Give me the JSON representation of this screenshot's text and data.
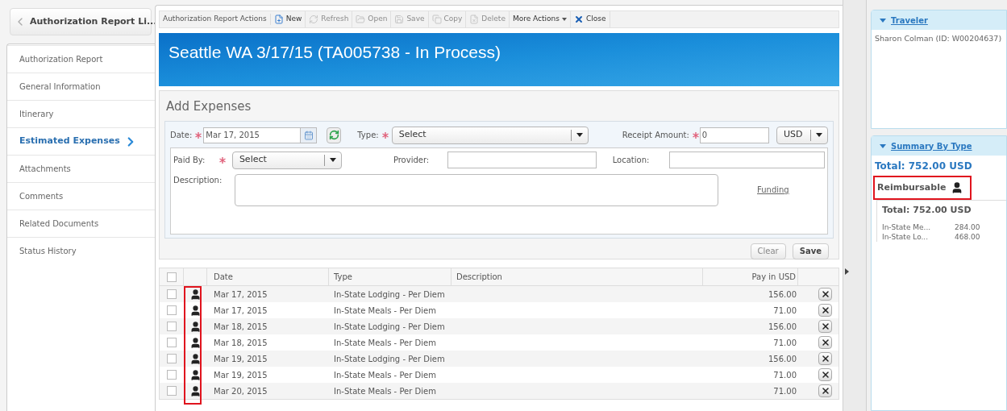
{
  "back_button": {
    "label": "Authorization Report Li..."
  },
  "nav": [
    {
      "label": "Authorization Report",
      "selected": false
    },
    {
      "label": "General Information",
      "selected": false
    },
    {
      "label": "Itinerary",
      "selected": false
    },
    {
      "label": "Estimated Expenses",
      "selected": true
    },
    {
      "label": "Attachments",
      "selected": false
    },
    {
      "label": "Comments",
      "selected": false
    },
    {
      "label": "Related Documents",
      "selected": false
    },
    {
      "label": "Status History",
      "selected": false
    }
  ],
  "toolbar": {
    "title": "Authorization Report Actions",
    "buttons": [
      {
        "kind": "new",
        "label": "New",
        "disabled": false
      },
      {
        "kind": "refresh",
        "label": "Refresh",
        "disabled": true
      },
      {
        "kind": "open",
        "label": "Open",
        "disabled": true
      },
      {
        "kind": "save",
        "label": "Save",
        "disabled": true
      },
      {
        "kind": "copy",
        "label": "Copy",
        "disabled": true
      },
      {
        "kind": "delete",
        "label": "Delete",
        "disabled": true
      },
      {
        "kind": "more",
        "label": "More Actions",
        "disabled": false
      },
      {
        "kind": "close",
        "label": "Close",
        "disabled": false
      }
    ]
  },
  "banner": {
    "title": "Seattle WA 3/17/15 (TA005738 - In Process)"
  },
  "add_expenses": {
    "title": "Add Expenses",
    "date": {
      "label": "Date:",
      "value": "Mar 17, 2015",
      "required": true
    },
    "type": {
      "label": "Type:",
      "value": "Select",
      "required": true
    },
    "receipt_amount": {
      "label": "Receipt Amount:",
      "value": "0",
      "required": true
    },
    "currency": {
      "value": "USD"
    },
    "paid_by": {
      "label": "Paid By:",
      "value": "Select",
      "required": true
    },
    "provider": {
      "label": "Provider:"
    },
    "location": {
      "label": "Location:"
    },
    "description": {
      "label": "Description:"
    },
    "funding_link": "Funding",
    "buttons": [
      "Clear",
      "Save"
    ]
  },
  "table": {
    "header_checked": false,
    "columns": [
      "Date",
      "Type",
      "Description",
      "Pay in USD"
    ],
    "rows": [
      {
        "checked": false,
        "date": "Mar 17, 2015",
        "type": "In-State Lodging - Per Diem",
        "amount": "156.00"
      },
      {
        "checked": false,
        "date": "Mar 17, 2015",
        "type": "In-State Meals - Per Diem",
        "amount": "71.00"
      },
      {
        "checked": false,
        "date": "Mar 18, 2015",
        "type": "In-State Lodging - Per Diem",
        "amount": "156.00"
      },
      {
        "checked": false,
        "date": "Mar 18, 2015",
        "type": "In-State Meals - Per Diem",
        "amount": "71.00"
      },
      {
        "checked": false,
        "date": "Mar 19, 2015",
        "type": "In-State Lodging - Per Diem",
        "amount": "156.00"
      },
      {
        "checked": false,
        "date": "Mar 19, 2015",
        "type": "In-State Meals - Per Diem",
        "amount": "71.00"
      },
      {
        "checked": false,
        "date": "Mar 20, 2015",
        "type": "In-State Meals - Per Diem",
        "amount": "71.00"
      }
    ]
  },
  "traveler": {
    "title": "Traveler",
    "name": "Sharon Colman (ID: W00204637)"
  },
  "summary": {
    "title": "Summary By Type",
    "total": "Total: 752.00 USD",
    "group": "Reimbursable",
    "group_total": "Total: 752.00 USD",
    "items": [
      {
        "label": "In-State Me...",
        "amount": "284.00"
      },
      {
        "label": "In-State Lo...",
        "amount": "468.00"
      }
    ]
  }
}
